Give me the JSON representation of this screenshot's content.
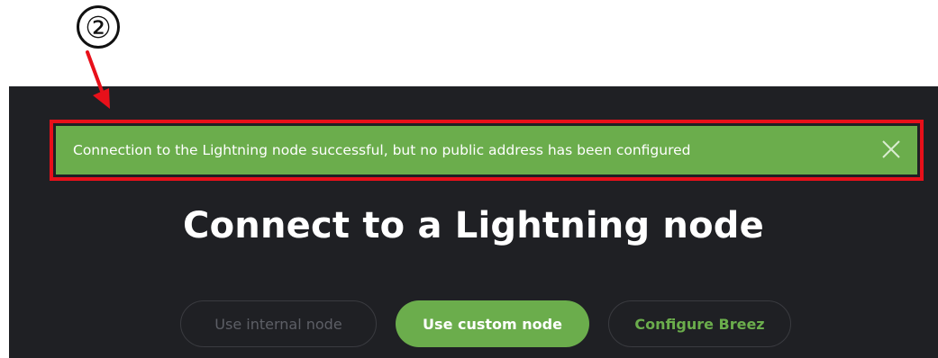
{
  "annotation": {
    "step_number": "②",
    "arrow_color": "#e8101a",
    "highlight_color": "#e8101a"
  },
  "alert": {
    "message": "Connection to the Lightning node successful, but no public address has been configured",
    "close_icon": "close-icon",
    "background": "#6bad4c"
  },
  "page": {
    "title": "Connect to a Lightning node",
    "background": "#1f2024"
  },
  "actions": {
    "internal_node_label": "Use internal node",
    "custom_node_label": "Use custom node",
    "configure_breez_label": "Configure Breez",
    "accent": "#6bad4c"
  }
}
